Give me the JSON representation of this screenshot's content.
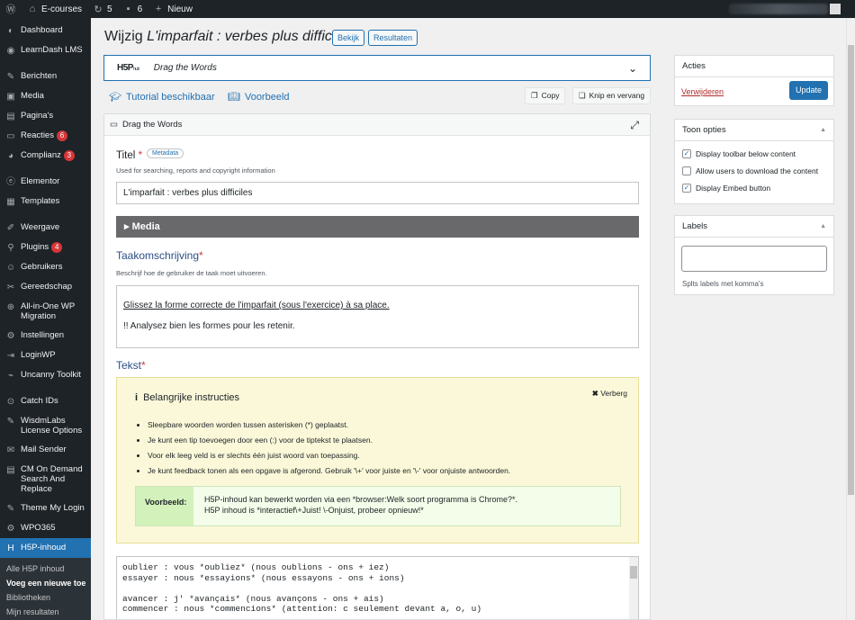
{
  "adminbar": {
    "site_name": "E-courses",
    "updates_count": "5",
    "comments_count": "6",
    "new_label": "Nieuw"
  },
  "sidebar": {
    "items": [
      {
        "label": "Dashboard",
        "icon": "dashboard-icon",
        "glyph": "◐"
      },
      {
        "label": "LearnDash LMS",
        "icon": "learndash-icon",
        "glyph": "◉"
      },
      {
        "label": "Berichten",
        "icon": "pin-icon",
        "glyph": "✎"
      },
      {
        "label": "Media",
        "icon": "media-icon",
        "glyph": "▣"
      },
      {
        "label": "Pagina's",
        "icon": "pages-icon",
        "glyph": "▤"
      },
      {
        "label": "Reacties",
        "icon": "comments-icon",
        "glyph": "▭",
        "badge": "6"
      },
      {
        "label": "Complianz",
        "icon": "complianz-icon",
        "glyph": "◕",
        "badge": "3"
      },
      {
        "label": "Elementor",
        "icon": "elementor-icon",
        "glyph": "ⓔ"
      },
      {
        "label": "Templates",
        "icon": "templates-icon",
        "glyph": "▦"
      },
      {
        "label": "Weergave",
        "icon": "appearance-icon",
        "glyph": "✐"
      },
      {
        "label": "Plugins",
        "icon": "plugins-icon",
        "glyph": "⚲",
        "badge": "4"
      },
      {
        "label": "Gebruikers",
        "icon": "users-icon",
        "glyph": "☺"
      },
      {
        "label": "Gereedschap",
        "icon": "tools-icon",
        "glyph": "✂"
      },
      {
        "label": "All-in-One WP Migration",
        "icon": "migration-icon",
        "glyph": "⊕"
      },
      {
        "label": "Instellingen",
        "icon": "settings-icon",
        "glyph": "⚙"
      },
      {
        "label": "LoginWP",
        "icon": "loginwp-icon",
        "glyph": "⇥"
      },
      {
        "label": "Uncanny Toolkit",
        "icon": "uncanny-icon",
        "glyph": "⌁"
      },
      {
        "label": "Catch IDs",
        "icon": "catch-ids-icon",
        "glyph": "⊙"
      },
      {
        "label": "WisdmLabs License Options",
        "icon": "wisdmlabs-icon",
        "glyph": "✎"
      },
      {
        "label": "Mail Sender",
        "icon": "mail-icon",
        "glyph": "✉"
      },
      {
        "label": "CM On Demand Search And Replace",
        "icon": "search-replace-icon",
        "glyph": "▤"
      },
      {
        "label": "Theme My Login",
        "icon": "theme-login-icon",
        "glyph": "✎"
      },
      {
        "label": "WPO365",
        "icon": "wpo365-icon",
        "glyph": "⚙"
      },
      {
        "label": "H5P-inhoud",
        "icon": "h5p-icon",
        "glyph": "H"
      }
    ],
    "submenu": [
      "Alle H5P inhoud",
      "Voeg een nieuwe toe",
      "Bibliotheken",
      "Mijn resultaten"
    ]
  },
  "header": {
    "title_prefix": "Wijzig",
    "title_italic": "L'imparfait : verbes plus difficiles",
    "view_button": "Bekijk",
    "results_button": "Resultaten"
  },
  "library": {
    "logo": "H5P",
    "logo_sub": "hub",
    "name": "Drag the Words"
  },
  "links": {
    "tutorial": "Tutorial beschikbaar",
    "example": "Voorbeeld",
    "copy": "Copy",
    "paste_replace": "Knip en vervang"
  },
  "editor": {
    "header_title": "Drag the Words",
    "title_label": "Titel",
    "metadata_button": "Metadata",
    "title_help": "Used for searching, reports and copyright information",
    "title_value": "L'imparfait : verbes plus difficiles",
    "media_label": "Media",
    "task_label": "Taakomschrijving",
    "task_help": "Beschrijf hoe de gebruiker de taak moet uitvoeren.",
    "task_line1": "Glissez la forme correcte de l'imparfait (sous l'exercice) à sa place.",
    "task_line2": "!! Analysez bien les formes pour les retenir.",
    "text_label": "Tekst",
    "instructions": {
      "title": "Belangrijke instructies",
      "hide": "Verberg",
      "bullets": [
        "Sleepbare woorden worden tussen asterisken (*) geplaatst.",
        "Je kunt een tip toevoegen door een (:) voor de tiptekst te plaatsen.",
        "Voor elk leeg veld is er slechts één juist woord van toepassing.",
        "Je kunt feedback tonen als een opgave is afgerond. Gebruik '\\+' voor juiste en '\\-' voor onjuiste antwoorden."
      ],
      "example_label": "Voorbeeld:",
      "example_line1": "H5P-inhoud kan bewerkt worden via een *browser:Welk soort programma is Chrome?*.",
      "example_line2": "H5P inhoud is *interactief\\+Juist! \\-Onjuist, probeer opnieuw!*"
    },
    "text_value": "oublier : vous *oubliez* (nous oublions - ons + iez)\nessayer : nous *essayions* (nous essayons - ons + ions)\n\navancer : j' *avançais* (nous avançons - ons + ais)\ncommencer : nous *commencions* (attention: c seulement devant a, o, u)"
  },
  "actions": {
    "title": "Acties",
    "delete": "Verwijderen",
    "update": "Update"
  },
  "display_options": {
    "title": "Toon opties",
    "options": [
      {
        "label": "Display toolbar below content",
        "checked": true
      },
      {
        "label": "Allow users to download the content",
        "checked": false
      },
      {
        "label": "Display Embed button",
        "checked": true
      }
    ]
  },
  "labels": {
    "title": "Labels",
    "help": "Splts labels met komma's"
  },
  "colors": {
    "accent": "#2271b1",
    "sidebar": "#1d2327",
    "badge": "#d63638",
    "instructions_bg": "#fbf8d9",
    "example_bg": "#f3fde9"
  }
}
